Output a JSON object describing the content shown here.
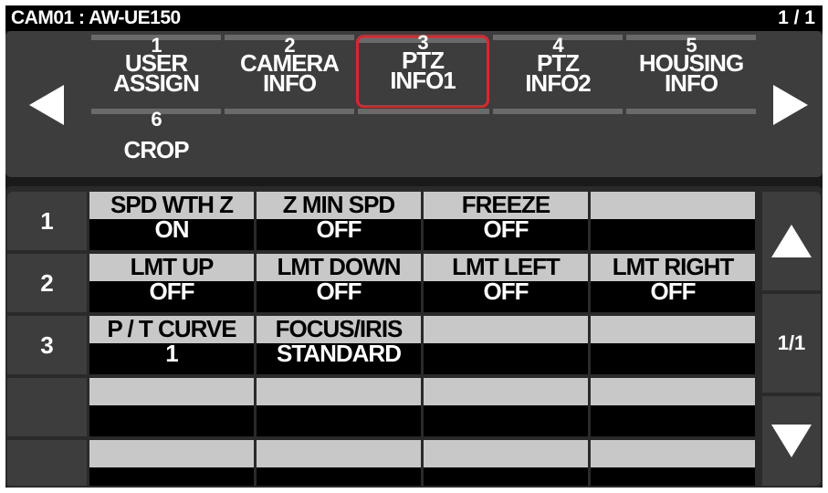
{
  "title": "CAM01 :  AW-UE150",
  "page": "1 / 1",
  "tabs": [
    {
      "num": "1",
      "line1": "USER",
      "line2": "ASSIGN"
    },
    {
      "num": "2",
      "line1": "CAMERA",
      "line2": "INFO"
    },
    {
      "num": "3",
      "line1": "PTZ",
      "line2": "INFO1"
    },
    {
      "num": "4",
      "line1": "PTZ",
      "line2": "INFO2"
    },
    {
      "num": "5",
      "line1": "HOUSING",
      "line2": "INFO"
    },
    {
      "num": "6",
      "line1": "CROP",
      "line2": ""
    },
    {
      "num": "",
      "line1": "",
      "line2": ""
    },
    {
      "num": "",
      "line1": "",
      "line2": ""
    },
    {
      "num": "",
      "line1": "",
      "line2": ""
    },
    {
      "num": "",
      "line1": "",
      "line2": ""
    }
  ],
  "selected_tab": "3",
  "rows": [
    {
      "label": "1",
      "cells": [
        {
          "header": "SPD WTH Z",
          "value": "ON"
        },
        {
          "header": "Z MIN SPD",
          "value": "OFF"
        },
        {
          "header": "FREEZE",
          "value": "OFF"
        },
        {
          "header": "",
          "value": ""
        }
      ]
    },
    {
      "label": "2",
      "cells": [
        {
          "header": "LMT UP",
          "value": "OFF"
        },
        {
          "header": "LMT DOWN",
          "value": "OFF"
        },
        {
          "header": "LMT LEFT",
          "value": "OFF"
        },
        {
          "header": "LMT RIGHT",
          "value": "OFF"
        }
      ]
    },
    {
      "label": "3",
      "cells": [
        {
          "header": "P / T CURVE",
          "value": "1"
        },
        {
          "header": "FOCUS/IRIS",
          "value": "STANDARD"
        },
        {
          "header": "",
          "value": ""
        },
        {
          "header": "",
          "value": ""
        }
      ]
    },
    {
      "label": "",
      "cells": [
        {
          "header": "",
          "value": ""
        },
        {
          "header": "",
          "value": ""
        },
        {
          "header": "",
          "value": ""
        },
        {
          "header": "",
          "value": ""
        }
      ]
    },
    {
      "label": "",
      "cells": [
        {
          "header": "",
          "value": ""
        },
        {
          "header": "",
          "value": ""
        },
        {
          "header": "",
          "value": ""
        },
        {
          "header": "",
          "value": ""
        }
      ]
    }
  ],
  "row_page": "1/1",
  "icons": {
    "prev_tab": "triangle-left-icon",
    "next_tab": "triangle-right-icon",
    "scroll_up": "triangle-up-icon",
    "scroll_down": "triangle-down-icon"
  },
  "colors": {
    "selection": "#e0232d",
    "background": "#1a1a1a",
    "button": "#3d3d3d",
    "cell_header": "#c8c8c8",
    "cell_value": "#000000"
  }
}
